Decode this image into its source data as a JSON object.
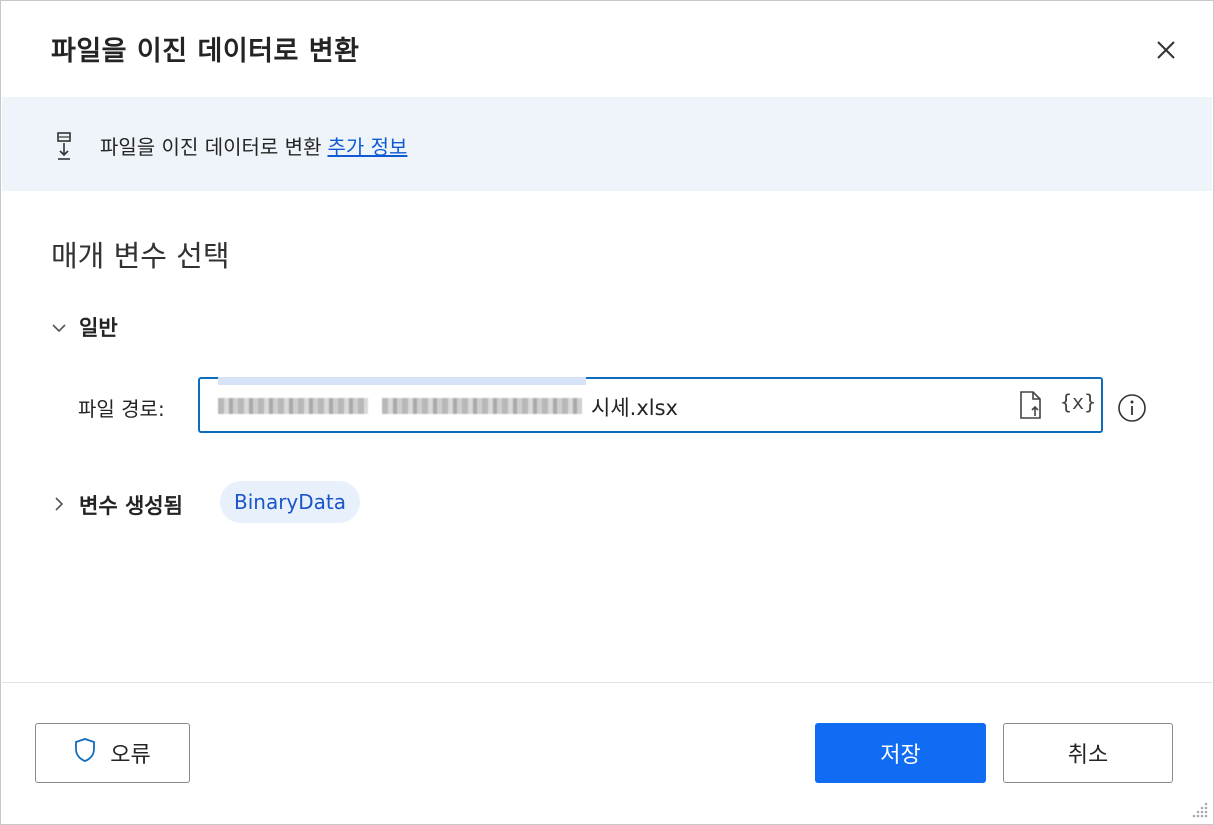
{
  "dialog": {
    "title": "파일을 이진 데이터로 변환"
  },
  "banner": {
    "text": "파일을 이진 데이터로 변환",
    "link": "추가 정보"
  },
  "section": {
    "title": "매개 변수 선택"
  },
  "general": {
    "header": "일반",
    "file_path_label": "파일 경로:",
    "file_path_value": "시세.xlsx",
    "var_button": "{x}"
  },
  "variables": {
    "header": "변수 생성됨",
    "chip": "BinaryData"
  },
  "footer": {
    "error_label": "오류",
    "save_label": "저장",
    "cancel_label": "취소"
  },
  "icons": {
    "close": "close-icon",
    "banner": "convert-file-icon",
    "file": "file-picker-icon",
    "info": "info-icon",
    "shield": "shield-icon"
  },
  "colors": {
    "accent": "#0f6cf3",
    "link": "#0f5bd6",
    "banner_bg": "#eff4fb",
    "chip_bg": "#e8f0fc"
  }
}
